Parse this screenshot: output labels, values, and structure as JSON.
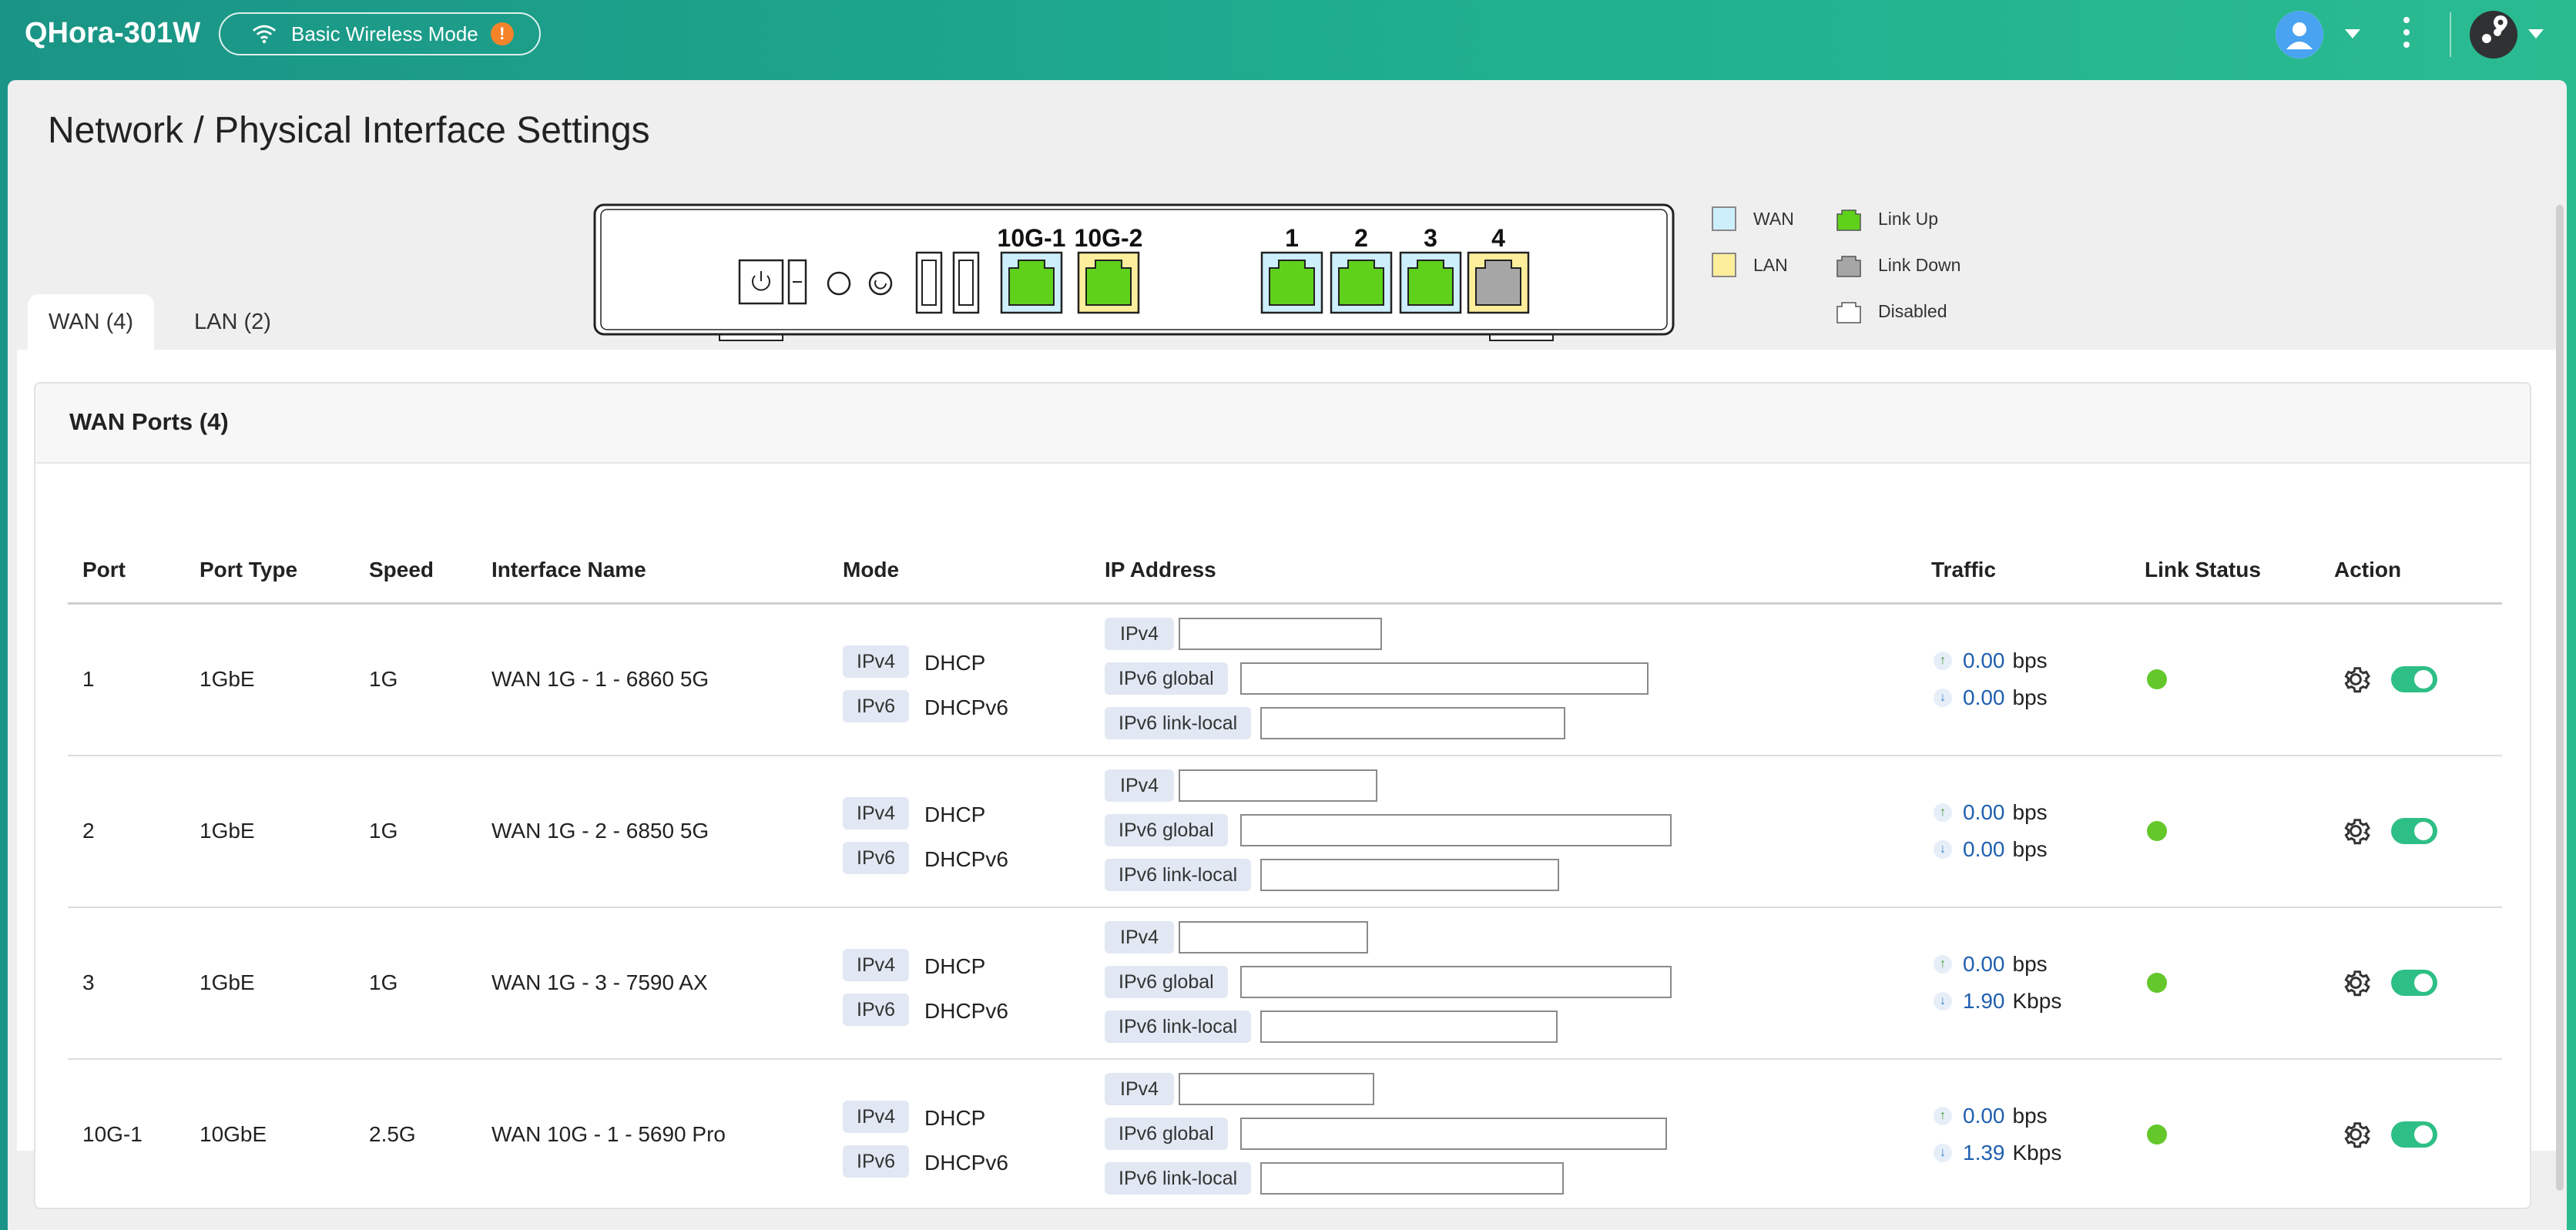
{
  "header": {
    "app_title": "QHora-301W",
    "mode_label": "Basic Wireless Mode",
    "warning_glyph": "!",
    "icons": [
      "wifi-icon",
      "warning-icon",
      "user-avatar-icon",
      "chevron-down-icon",
      "more-vert-icon",
      "locator-icon"
    ]
  },
  "page": {
    "title": "Network / Physical Interface Settings"
  },
  "device": {
    "ports": [
      {
        "label": "10G-1",
        "role": "WAN",
        "state": "Link Up"
      },
      {
        "label": "10G-2",
        "role": "LAN",
        "state": "Link Up"
      },
      {
        "label": "1",
        "role": "WAN",
        "state": "Link Up"
      },
      {
        "label": "2",
        "role": "WAN",
        "state": "Link Up"
      },
      {
        "label": "3",
        "role": "WAN",
        "state": "Link Up"
      },
      {
        "label": "4",
        "role": "LAN",
        "state": "Link Down"
      }
    ]
  },
  "legend": {
    "wan": "WAN",
    "lan": "LAN",
    "link_up": "Link Up",
    "link_down": "Link Down",
    "disabled": "Disabled",
    "colors": {
      "wan": "#cdeefb",
      "lan": "#fdee9c",
      "link_up": "#5fd11a",
      "link_down": "#a6a6a6"
    }
  },
  "tabs": [
    {
      "label": "WAN (4)",
      "active": true
    },
    {
      "label": "LAN (2)",
      "active": false
    }
  ],
  "wan_section": {
    "title": "WAN Ports (4)",
    "columns": [
      "Port",
      "Port Type",
      "Speed",
      "Interface Name",
      "Mode",
      "IP Address",
      "Traffic",
      "Link Status",
      "Action"
    ],
    "rows": [
      {
        "port": "1",
        "port_type": "1GbE",
        "speed": "1G",
        "interface_name": "WAN 1G - 1 - 6860 5G",
        "mode_ipv4_tag": "IPv4",
        "mode_ipv4": "DHCP",
        "mode_ipv6_tag": "IPv6",
        "mode_ipv6": "DHCPv6",
        "ip_labels": [
          "IPv4",
          "IPv6 global",
          "IPv6 link-local"
        ],
        "tx_value": "0.00",
        "tx_unit": "bps",
        "rx_value": "0.00",
        "rx_unit": "bps",
        "enabled": true
      },
      {
        "port": "2",
        "port_type": "1GbE",
        "speed": "1G",
        "interface_name": "WAN 1G - 2 - 6850 5G",
        "mode_ipv4_tag": "IPv4",
        "mode_ipv4": "DHCP",
        "mode_ipv6_tag": "IPv6",
        "mode_ipv6": "DHCPv6",
        "ip_labels": [
          "IPv4",
          "IPv6 global",
          "IPv6 link-local"
        ],
        "tx_value": "0.00",
        "tx_unit": "bps",
        "rx_value": "0.00",
        "rx_unit": "bps",
        "enabled": true
      },
      {
        "port": "3",
        "port_type": "1GbE",
        "speed": "1G",
        "interface_name": "WAN 1G - 3 - 7590 AX",
        "mode_ipv4_tag": "IPv4",
        "mode_ipv4": "DHCP",
        "mode_ipv6_tag": "IPv6",
        "mode_ipv6": "DHCPv6",
        "ip_labels": [
          "IPv4",
          "IPv6 global",
          "IPv6 link-local"
        ],
        "tx_value": "0.00",
        "tx_unit": "bps",
        "rx_value": "1.90",
        "rx_unit": "Kbps",
        "enabled": true
      },
      {
        "port": "10G-1",
        "port_type": "10GbE",
        "speed": "2.5G",
        "interface_name": "WAN 10G - 1 - 5690 Pro",
        "mode_ipv4_tag": "IPv4",
        "mode_ipv4": "DHCP",
        "mode_ipv6_tag": "IPv6",
        "mode_ipv6": "DHCPv6",
        "ip_labels": [
          "IPv4",
          "IPv6 global",
          "IPv6 link-local"
        ],
        "tx_value": "0.00",
        "tx_unit": "bps",
        "rx_value": "1.39",
        "rx_unit": "Kbps",
        "enabled": true
      }
    ]
  }
}
